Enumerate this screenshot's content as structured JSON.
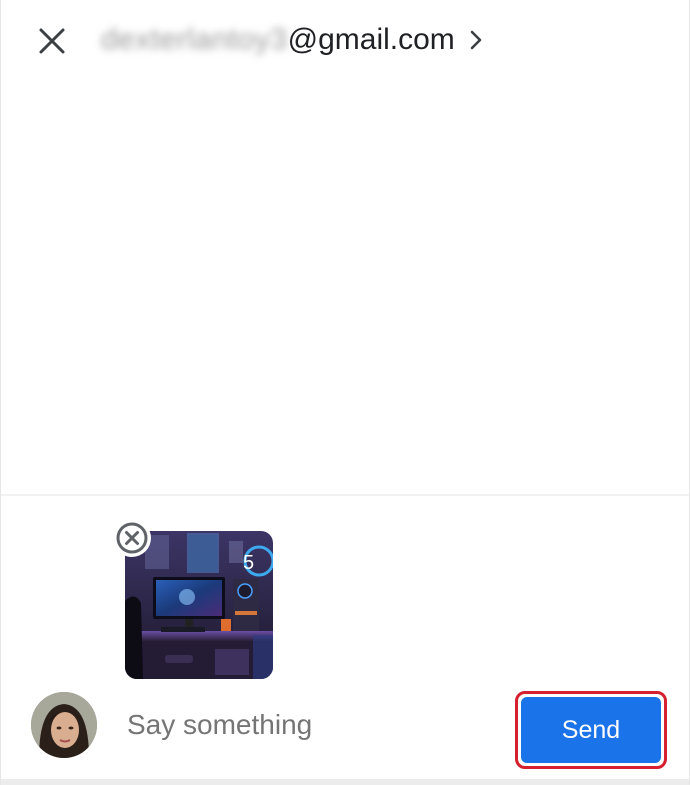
{
  "header": {
    "recipient_blurred": "dexterlantoy3",
    "recipient_domain": "@gmail.com",
    "close_icon": "close-icon",
    "chevron_icon": "chevron-right-icon"
  },
  "attachment": {
    "thumbnail_icon": "gaming-setup-photo",
    "remove_icon": "remove-circle-icon"
  },
  "composer": {
    "placeholder": "Say something",
    "send_label": "Send"
  },
  "colors": {
    "accent": "#1a73e8",
    "highlight": "#d4202f",
    "text": "#202124",
    "placeholder": "#757575"
  }
}
